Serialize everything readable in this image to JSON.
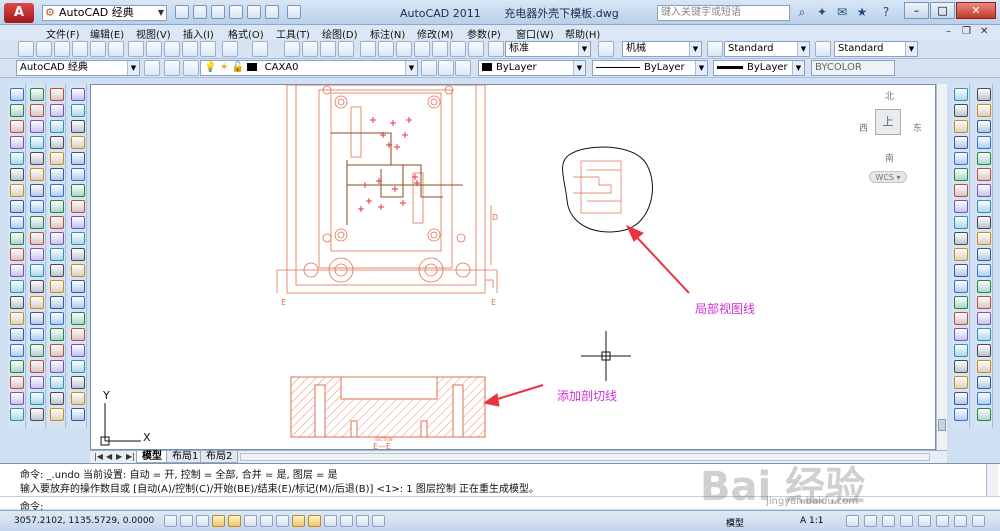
{
  "titlebar": {
    "app_logo": "A",
    "workspace": "AutoCAD 经典",
    "app_name": "AutoCAD 2011",
    "document": "充电器外壳下模板.dwg",
    "search_placeholder": "键入关键字或短语"
  },
  "menu": {
    "items": [
      "文件(F)",
      "编辑(E)",
      "视图(V)",
      "插入(I)",
      "格式(O)",
      "工具(T)",
      "绘图(D)",
      "标注(N)",
      "修改(M)",
      "参数(P)",
      "窗口(W)",
      "帮助(H)"
    ]
  },
  "styles_toolbar": {
    "text_style": "标准",
    "dim_style": "机械",
    "table_style": "Standard",
    "multileader_style": "Standard"
  },
  "layers_toolbar": {
    "workspace": "AutoCAD 经典",
    "layer": "CAXA0",
    "color": "ByLayer",
    "linetype": "ByLayer",
    "lineweight": "ByLayer",
    "plotstyle": "BYCOLOR"
  },
  "viewcube": {
    "north": "北",
    "south": "南",
    "east": "东",
    "west": "西",
    "top": "上",
    "ucs": "WCS"
  },
  "drawing": {
    "label_e_left": "E",
    "label_e_right": "E",
    "label_d": "D",
    "section_caption": "SECTION",
    "section_title": "E—E"
  },
  "annotations": {
    "detail_label": "局部视图线",
    "section_label": "添加剖切线",
    "arrow_color": "#e8343f"
  },
  "ucs_icon": {
    "x": "X",
    "y": "Y"
  },
  "layout_tabs": [
    "模型",
    "布局1",
    "布局2"
  ],
  "command": {
    "line1": "命令: _.undo 当前设置: 自动 = 开, 控制 = 全部, 合并 = 是, 图层 = 是",
    "line2": "输入要放弃的操作数目或 [自动(A)/控制(C)/开始(BE)/结束(E)/标记(M)/后退(B)] <1>: 1 图层控制 正在重生成模型。",
    "prompt": "命令:"
  },
  "status": {
    "coords": "3057.2102, 1135.5729, 0.0000",
    "space": "模型",
    "scale": "A 1:1"
  },
  "watermark": {
    "brand": "Bai 经验",
    "url": "jingyan.baidu.com"
  }
}
